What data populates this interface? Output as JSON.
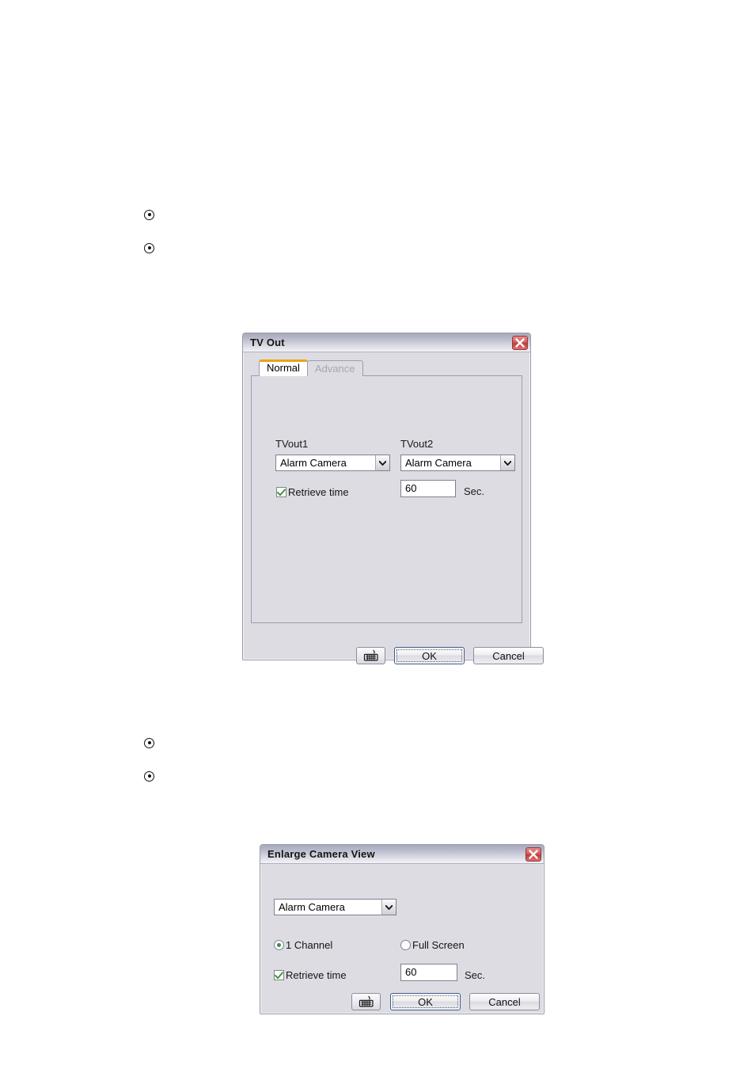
{
  "document": {
    "background_color": "#ffffff",
    "bullet_groups": [
      {
        "items": [
          {
            "text": ""
          },
          {
            "text": ""
          }
        ]
      },
      {
        "items": [
          {
            "text": ""
          },
          {
            "text": ""
          }
        ]
      }
    ]
  },
  "colors": {
    "dialog_background": "#dedce3",
    "titlebar_top": "#a6a8bd",
    "titlebar_bottom": "#f3f3f7",
    "close_button_red": "#c74040",
    "active_tab_accent": "#e8a517",
    "checkmark_green": "#3f8f3f",
    "radio_dot_green": "#3f8f3f",
    "field_border": "#7e8190"
  },
  "tv_out_dialog": {
    "title": "TV Out",
    "close_icon": "close-icon",
    "tabs": [
      {
        "label": "Normal",
        "active": true
      },
      {
        "label": "Advance",
        "active": false
      }
    ],
    "fields": {
      "tvout1_label": "TVout1",
      "tvout1_value": "Alarm Camera",
      "tvout2_label": "TVout2",
      "tvout2_value": "Alarm Camera",
      "retrieve_time_label": "Retrieve time",
      "retrieve_time_checked": true,
      "retrieve_time_value": "60",
      "seconds_label": "Sec."
    },
    "buttons": {
      "keyboard_icon": "keyboard-icon",
      "ok_label": "OK",
      "cancel_label": "Cancel"
    },
    "dropdown_arrow_icon": "chevron-down-icon"
  },
  "enlarge_camera_view_dialog": {
    "title": "Enlarge Camera View",
    "close_icon": "close-icon",
    "fields": {
      "camera_value": "Alarm Camera",
      "view_mode_options": [
        {
          "label": "1 Channel",
          "selected": true
        },
        {
          "label": "Full Screen",
          "selected": false
        }
      ],
      "retrieve_time_label": "Retrieve time",
      "retrieve_time_checked": true,
      "retrieve_time_value": "60",
      "seconds_label": "Sec."
    },
    "buttons": {
      "keyboard_icon": "keyboard-icon",
      "ok_label": "OK",
      "cancel_label": "Cancel"
    },
    "dropdown_arrow_icon": "chevron-down-icon"
  }
}
